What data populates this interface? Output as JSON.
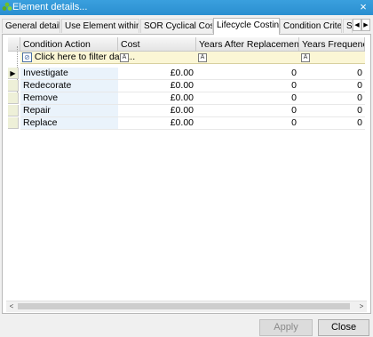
{
  "window": {
    "title": "Element details...",
    "close_glyph": "×",
    "icon": "element-icon"
  },
  "tabs": [
    {
      "label": "General details"
    },
    {
      "label": "Use Element within .."
    },
    {
      "label": "SOR Cyclical Costs"
    },
    {
      "label": "Lifecycle Costing"
    },
    {
      "label": "Condition Criteria"
    },
    {
      "label": "S"
    }
  ],
  "tab_scroll": {
    "left": "◀",
    "right": "▶"
  },
  "grid": {
    "columns": [
      "Condition Action",
      "Cost",
      "Years After Replacement",
      "Years Frequency"
    ],
    "filter": {
      "text": "Click here to filter data...",
      "cond_icon_text": "A"
    },
    "current_row_glyph": "▶",
    "rows": [
      {
        "action": "Investigate",
        "cost": "£0.00",
        "years_after": "0",
        "freq": "0"
      },
      {
        "action": "Redecorate",
        "cost": "£0.00",
        "years_after": "0",
        "freq": "0"
      },
      {
        "action": "Remove",
        "cost": "£0.00",
        "years_after": "0",
        "freq": "0"
      },
      {
        "action": "Repair",
        "cost": "£0.00",
        "years_after": "0",
        "freq": "0"
      },
      {
        "action": "Replace",
        "cost": "£0.00",
        "years_after": "0",
        "freq": "0"
      }
    ]
  },
  "scrollbar": {
    "left": "<",
    "right": ">"
  },
  "buttons": {
    "apply": "Apply",
    "close": "Close"
  },
  "colors": {
    "title_bar": "#2a8fd0",
    "filter_row": "#fbf6d5",
    "selection_column": "#eaf3fb"
  }
}
